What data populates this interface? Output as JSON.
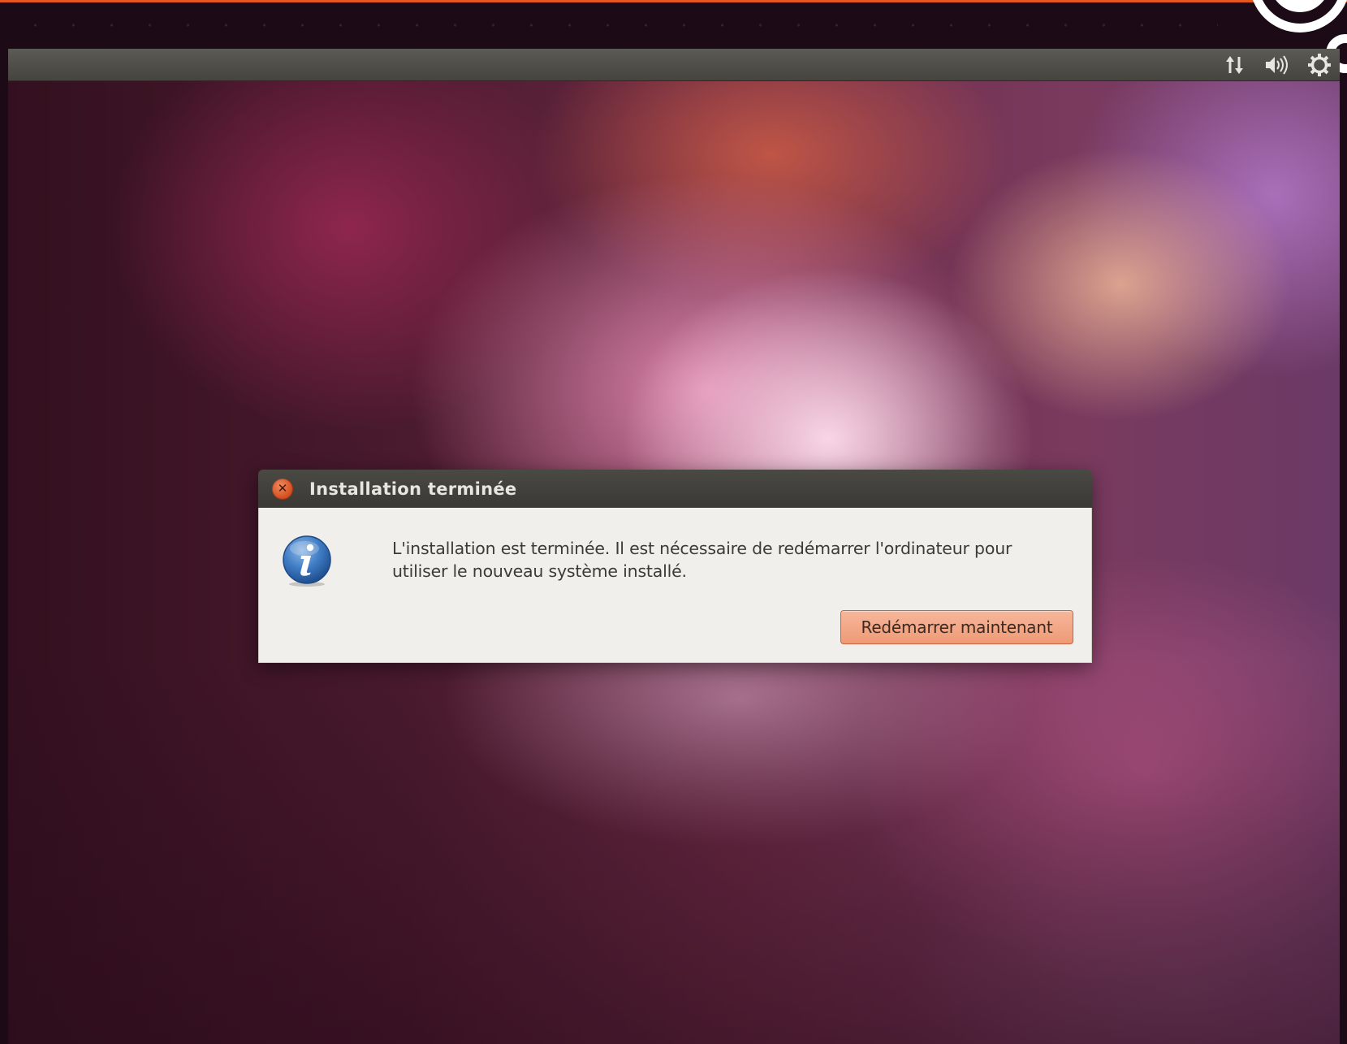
{
  "panel": {
    "indicators": [
      {
        "icon": "network-icon"
      },
      {
        "icon": "volume-icon"
      },
      {
        "icon": "gear-icon"
      }
    ]
  },
  "dialog": {
    "title": "Installation terminée",
    "message": "L'installation est terminée. Il est nécessaire de redémarrer l'ordinateur pour utiliser le nouveau système installé.",
    "restart_label": "Redémarrer maintenant",
    "icon": "info-icon"
  },
  "colors": {
    "accent": "#e6561f",
    "button": "#f0a07c",
    "titlebar": "#3f3e3a",
    "dialog_bg": "#f1efec"
  }
}
